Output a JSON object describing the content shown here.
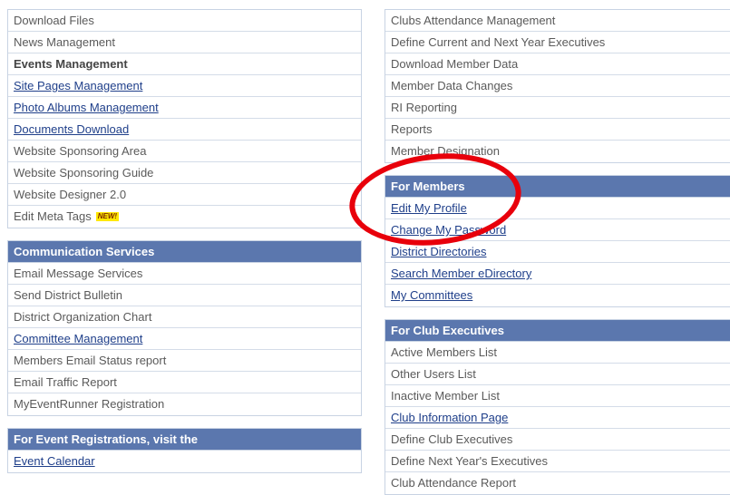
{
  "left_top": {
    "items": [
      {
        "label": "Download Files",
        "style": "plain"
      },
      {
        "label": "News Management",
        "style": "plain"
      },
      {
        "label": "Events Management",
        "style": "bold"
      },
      {
        "label": "Site Pages Management",
        "style": "link"
      },
      {
        "label": "Photo Albums Management",
        "style": "link"
      },
      {
        "label": "Documents Download",
        "style": "link"
      },
      {
        "label": "Website Sponsoring Area",
        "style": "plain"
      },
      {
        "label": "Website Sponsoring Guide",
        "style": "plain"
      },
      {
        "label": "Website Designer 2.0",
        "style": "plain"
      },
      {
        "label": "Edit Meta Tags",
        "style": "plain",
        "badge": "NEW!"
      }
    ]
  },
  "communication": {
    "title": "Communication Services",
    "items": [
      {
        "label": "Email Message Services",
        "style": "plain"
      },
      {
        "label": "Send District Bulletin",
        "style": "plain"
      },
      {
        "label": "District Organization Chart",
        "style": "plain"
      },
      {
        "label": "Committee Management",
        "style": "link"
      },
      {
        "label": "Members Email Status report",
        "style": "plain"
      },
      {
        "label": "Email Traffic Report",
        "style": "plain"
      },
      {
        "label": "MyEventRunner Registration",
        "style": "plain"
      }
    ]
  },
  "event_reg": {
    "title": "For Event Registrations, visit the",
    "items": [
      {
        "label": "Event Calendar",
        "style": "link"
      }
    ]
  },
  "right_top": {
    "items": [
      {
        "label": "Clubs Attendance Management",
        "style": "plain"
      },
      {
        "label": "Define Current and Next Year Executives",
        "style": "plain"
      },
      {
        "label": "Download Member Data",
        "style": "plain"
      },
      {
        "label": "Member Data Changes",
        "style": "plain"
      },
      {
        "label": "RI Reporting",
        "style": "plain"
      },
      {
        "label": "Reports",
        "style": "plain"
      },
      {
        "label": "Member Designation",
        "style": "plain"
      }
    ]
  },
  "for_members": {
    "title": "For Members",
    "items": [
      {
        "label": "Edit My Profile",
        "style": "link"
      },
      {
        "label": "Change My Password",
        "style": "link"
      },
      {
        "label": "District Directories",
        "style": "link"
      },
      {
        "label": "Search Member eDirectory",
        "style": "link"
      },
      {
        "label": "My Committees",
        "style": "link"
      }
    ]
  },
  "club_exec": {
    "title": "For Club Executives",
    "items": [
      {
        "label": "Active Members List",
        "style": "plain"
      },
      {
        "label": "Other Users List",
        "style": "plain"
      },
      {
        "label": "Inactive Member List",
        "style": "plain"
      },
      {
        "label": "Club Information Page",
        "style": "link"
      },
      {
        "label": "Define Club Executives",
        "style": "plain"
      },
      {
        "label": "Define Next Year's Executives",
        "style": "plain"
      },
      {
        "label": "Club Attendance Report",
        "style": "plain"
      }
    ]
  },
  "annotation": {
    "color": "#e8000b"
  }
}
